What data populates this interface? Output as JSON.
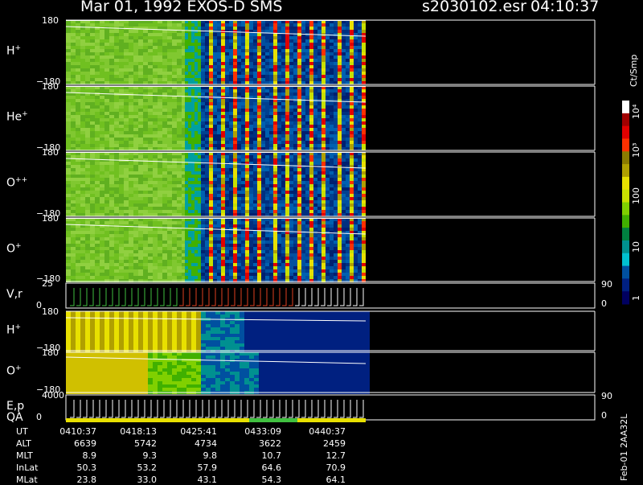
{
  "header": {
    "title_left": "Mar 01, 1992   EXOS-D SMS",
    "file": "s2030102.esr",
    "time": "04:10:37"
  },
  "panels": [
    {
      "label": "H",
      "charge": "+",
      "ytop": "180",
      "ybot": "−180",
      "kind": "spin"
    },
    {
      "label": "He",
      "charge": "+",
      "ytop": "180",
      "ybot": "−180",
      "kind": "spin"
    },
    {
      "label": "O",
      "charge": "++",
      "ytop": "180",
      "ybot": "−180",
      "kind": "spin"
    },
    {
      "label": "O",
      "charge": "+",
      "ytop": "180",
      "ybot": "−180",
      "kind": "spin"
    },
    {
      "label": "V,r",
      "charge": "",
      "ytop": "25",
      "ybot": "0",
      "kind": "line",
      "rtop": "90",
      "rbot": "0"
    },
    {
      "label": "H",
      "charge": "+",
      "ytop": "180",
      "ybot": "−180",
      "kind": "h2"
    },
    {
      "label": "O",
      "charge": "+",
      "ytop": "180",
      "ybot": "−180",
      "kind": "o2"
    },
    {
      "label": "E,p",
      "label2": "QA",
      "charge": "",
      "ytop": "4000",
      "ybot": "0",
      "kind": "line2",
      "rtop": "90",
      "rbot": "0"
    }
  ],
  "colorbar": {
    "unit": "Ct/Smp",
    "ticks": [
      "10⁴",
      "10³",
      "100",
      "10",
      "1"
    ],
    "colors": [
      "#ffffff",
      "#a00000",
      "#e00000",
      "#ff3000",
      "#8a7a00",
      "#b0a000",
      "#e8e000",
      "#c8e000",
      "#80d000",
      "#40b000",
      "#008040",
      "#009090",
      "#00c0d0",
      "#0050a0",
      "#002080",
      "#000060"
    ]
  },
  "footer": {
    "row_labels": [
      "UT",
      "ALT",
      "MLT",
      "InLat",
      "MLat"
    ],
    "columns": [
      [
        "0410:37",
        "6639",
        "8.9",
        "50.3",
        "23.8"
      ],
      [
        "0418:13",
        "5742",
        "9.3",
        "53.2",
        "33.0"
      ],
      [
        "0425:41",
        "4734",
        "9.8",
        "57.9",
        "43.1"
      ],
      [
        "0433:09",
        "3622",
        "10.7",
        "64.6",
        "54.3"
      ],
      [
        "0440:37",
        "2459",
        "12.7",
        "70.9",
        "64.1"
      ]
    ],
    "side_note": "Feb-01 2AA32L"
  },
  "chart_data": {
    "type": "heatmap",
    "title": "Mar 01, 1992   EXOS-D SMS",
    "x_ticks": [
      "0410:37",
      "0418:13",
      "0425:41",
      "0433:09",
      "0440:37"
    ],
    "color_scale": "log",
    "color_range": [
      1,
      10000
    ],
    "colorbar_label": "Ct/Smp",
    "series": [
      {
        "name": "H+",
        "ylim": [
          -180,
          180
        ]
      },
      {
        "name": "He+",
        "ylim": [
          -180,
          180
        ]
      },
      {
        "name": "O++",
        "ylim": [
          -180,
          180
        ]
      },
      {
        "name": "O+",
        "ylim": [
          -180,
          180
        ]
      },
      {
        "name": "V,r",
        "ylim": [
          0,
          25
        ]
      },
      {
        "name": "H+",
        "ylim": [
          -180,
          180
        ]
      },
      {
        "name": "O+",
        "ylim": [
          -180,
          180
        ]
      },
      {
        "name": "E,p",
        "ylim": [
          0,
          4000
        ]
      }
    ]
  }
}
